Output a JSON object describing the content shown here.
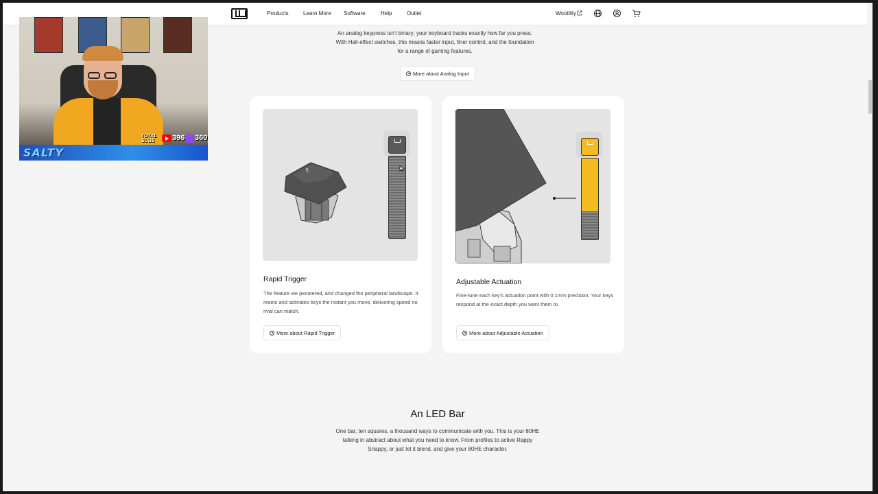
{
  "nav": {
    "logo": "wooting-logo",
    "links": [
      "Products",
      "Learn More",
      "Software",
      "Help",
      "Outlet"
    ],
    "wootility_label": "Wootility",
    "icons": [
      "external-link-icon",
      "globe-icon",
      "account-icon",
      "cart-icon"
    ]
  },
  "stream_overlay": {
    "brand": "SALTY",
    "total_subs_label": "TOTAL SUBS",
    "youtube_count": "396",
    "twitch_count": "360"
  },
  "intro": {
    "text": "An analog keypress isn't binary; your keyboard tracks exactly how far you press. With Hall-effect switches, this means faster input, finer control, and the foundation for a range of gaming features.",
    "button_label": "More about Analog Input"
  },
  "cards": [
    {
      "title": "Rapid Trigger",
      "description": "The feature we pioneered, and changed the peripheral landscape. It resets and activates keys the instant you move, delivering speed no rival can match.",
      "button_label": "More about Rapid Trigger",
      "indicator_fill": 0.0
    },
    {
      "title": "Adjustable Actuation",
      "description": "Fine-tune each key's actuation point with 0.1mm precision. Your keys respond at the exact depth you want them to.",
      "button_label": "More about Adjustable Actuation",
      "indicator_fill": 0.65,
      "accent_color": "#f5b922"
    }
  ],
  "led_section": {
    "title": "An LED Bar",
    "description": "One bar, ten squares, a thousand ways to communicate with you. This is your 80HE talking in abstract about what you need to know. From profiles to active Rappy Snappy, or just let it blend, and give your 80HE character."
  }
}
